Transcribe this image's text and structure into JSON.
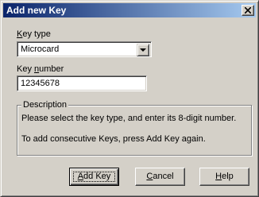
{
  "window": {
    "title": "Add new Key"
  },
  "key_type": {
    "label_pre": "",
    "label_mnemonic": "K",
    "label_post": "ey type",
    "selected": "Microcard"
  },
  "key_number": {
    "label_pre": "Key ",
    "label_mnemonic": "n",
    "label_post": "umber",
    "value": "12345678"
  },
  "description": {
    "title": "Description",
    "line1": "Please select the key type, and enter its 8-digit number.",
    "line2": "To add consecutive Keys, press Add Key again."
  },
  "buttons": {
    "add_key": {
      "pre": "",
      "mnemonic": "A",
      "post": "dd Key"
    },
    "cancel": {
      "pre": "",
      "mnemonic": "C",
      "post": "ancel"
    },
    "help": {
      "pre": "",
      "mnemonic": "H",
      "post": "elp"
    }
  }
}
